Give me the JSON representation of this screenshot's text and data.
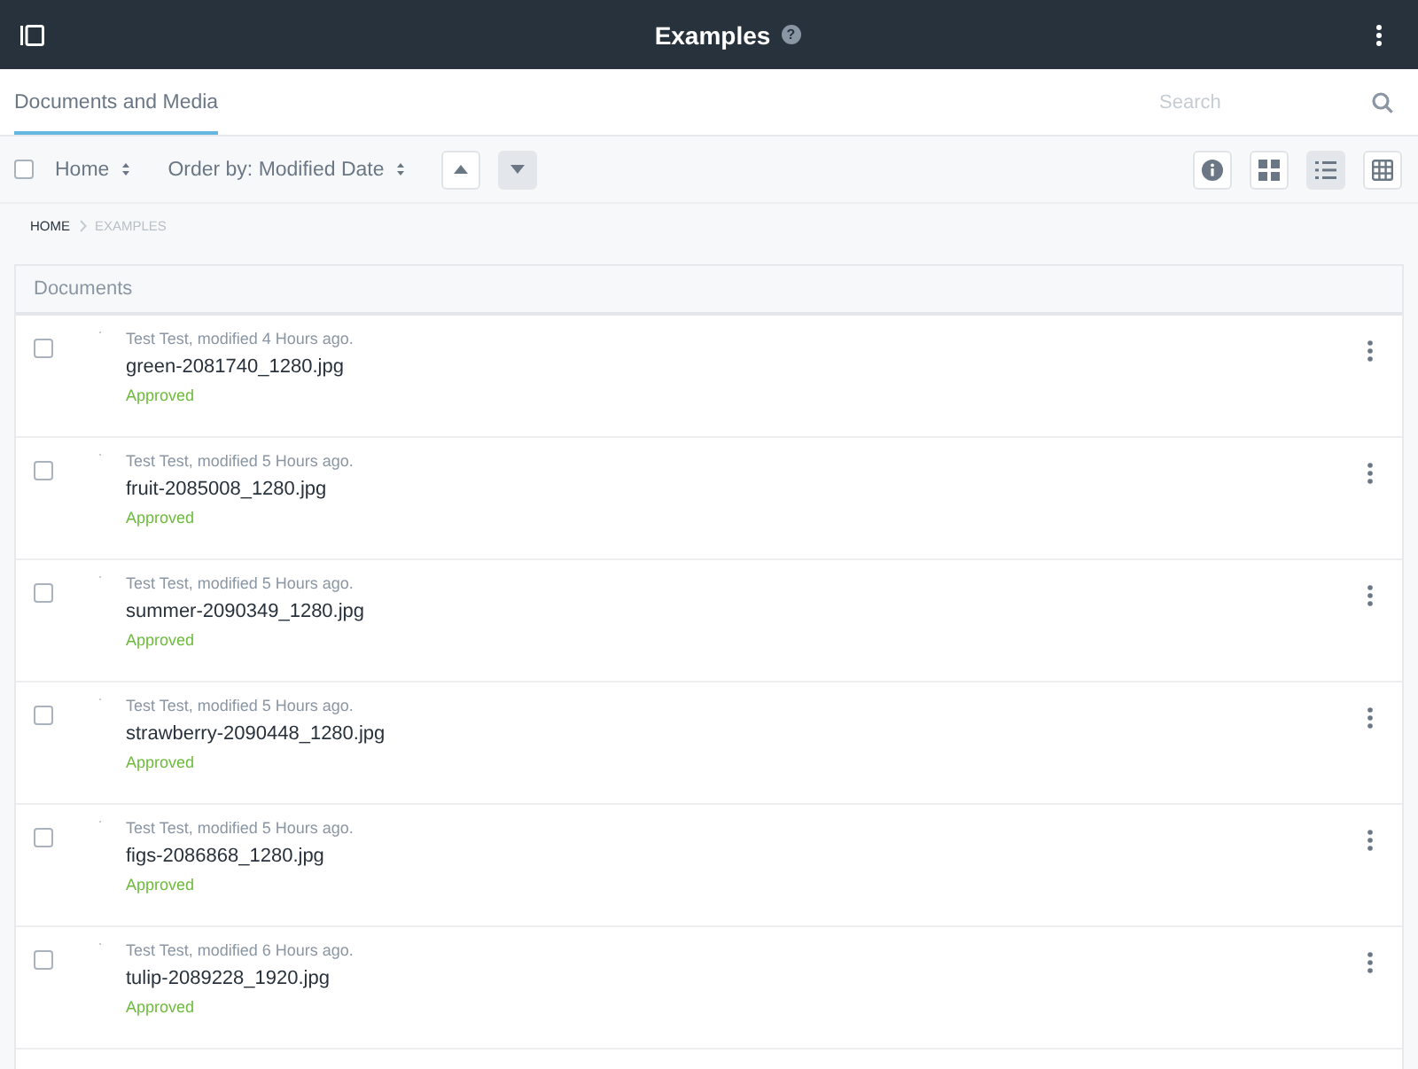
{
  "header": {
    "title": "Examples",
    "help": "?"
  },
  "nav": {
    "tabs": [
      {
        "label": "Documents and Media",
        "selected": true
      }
    ],
    "search": {
      "placeholder": "Search"
    }
  },
  "toolbar": {
    "select_all": {
      "checked": false
    },
    "filter": "Home",
    "order": "Order by: Modified Date",
    "sort": [
      {
        "kind": "up",
        "selected": false
      },
      {
        "kind": "down",
        "selected": true
      }
    ],
    "views": [
      {
        "kind": "info",
        "selected": false
      },
      {
        "kind": "cards",
        "selected": false
      },
      {
        "kind": "list",
        "selected": true
      },
      {
        "kind": "table",
        "selected": false
      }
    ]
  },
  "breadcrumb": [
    {
      "label": "HOME",
      "current": false
    },
    {
      "label": "EXAMPLES",
      "current": true
    }
  ],
  "panel": {
    "title": "Documents",
    "rows": [
      {
        "checked": false,
        "meta": "Test Test, modified 4 Hours ago.",
        "name": "green-2081740_1280.jpg",
        "status": "Approved"
      },
      {
        "checked": false,
        "meta": "Test Test, modified 5 Hours ago.",
        "name": "fruit-2085008_1280.jpg",
        "status": "Approved"
      },
      {
        "checked": false,
        "meta": "Test Test, modified 5 Hours ago.",
        "name": "summer-2090349_1280.jpg",
        "status": "Approved"
      },
      {
        "checked": false,
        "meta": "Test Test, modified 5 Hours ago.",
        "name": "strawberry-2090448_1280.jpg",
        "status": "Approved"
      },
      {
        "checked": false,
        "meta": "Test Test, modified 5 Hours ago.",
        "name": "figs-2086868_1280.jpg",
        "status": "Approved"
      },
      {
        "checked": false,
        "meta": "Test Test, modified 6 Hours ago.",
        "name": "tulip-2089228_1920.jpg",
        "status": "Approved"
      }
    ]
  }
}
